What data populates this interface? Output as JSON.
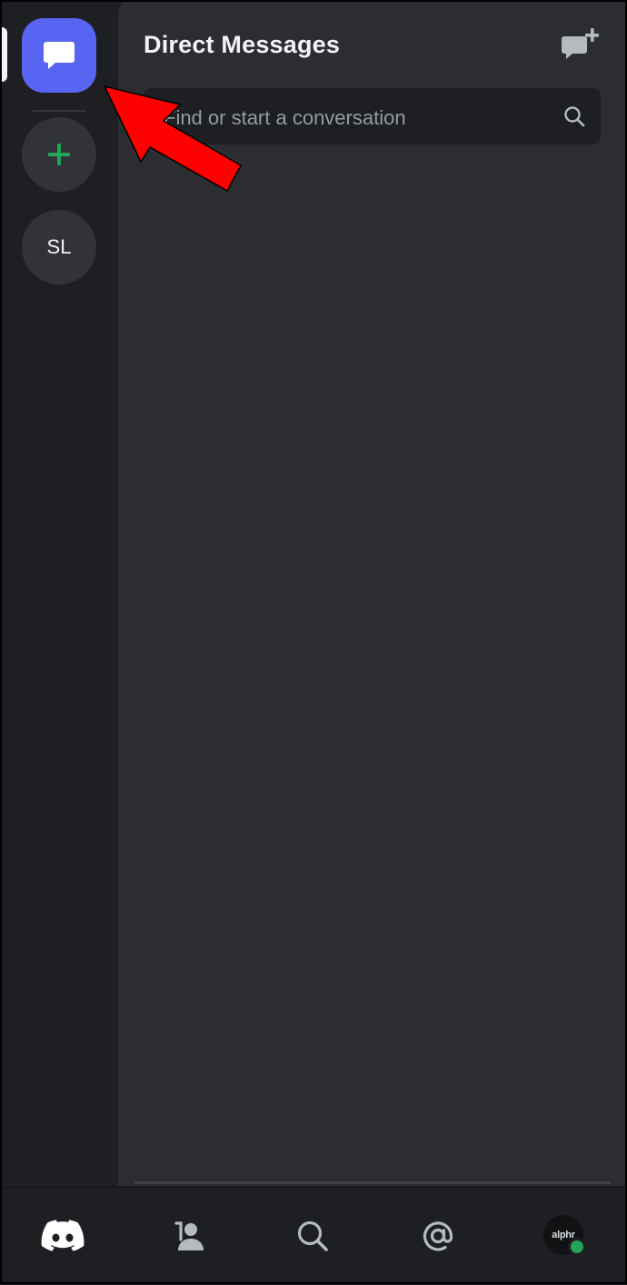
{
  "app": {
    "name": "Discord"
  },
  "colors": {
    "blurple": "#5865f2",
    "green": "#23a559",
    "annotation": "#ff0000"
  },
  "rail": {
    "home_icon": "chat-bubble-icon",
    "add_server_icon": "plus-icon",
    "servers": [
      {
        "label": "SL"
      }
    ]
  },
  "panel": {
    "title": "Direct Messages",
    "new_dm_icon": "new-message-icon",
    "search": {
      "placeholder": "Find or start a conversation",
      "icon": "search-icon"
    }
  },
  "bottom_nav": {
    "items": [
      {
        "icon": "discord-home-icon",
        "active": true
      },
      {
        "icon": "friends-icon"
      },
      {
        "icon": "search-icon"
      },
      {
        "icon": "mentions-icon"
      },
      {
        "icon": "profile-avatar",
        "avatar_text": "alphr",
        "status": "online"
      }
    ]
  }
}
